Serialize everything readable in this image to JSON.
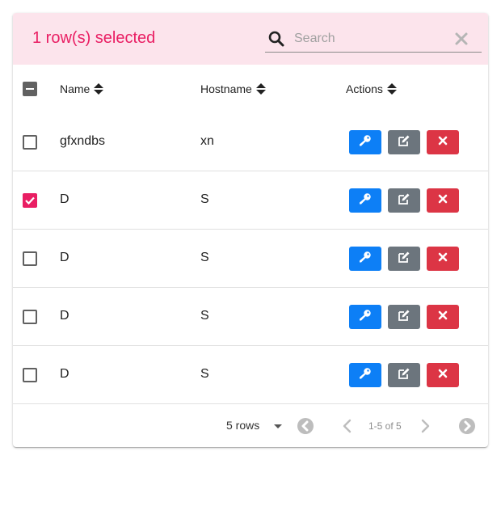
{
  "toolbar": {
    "selected_text": "1 row(s) selected",
    "search_placeholder": "Search",
    "search_value": ""
  },
  "columns": {
    "name": "Name",
    "hostname": "Hostname",
    "actions": "Actions"
  },
  "rows": [
    {
      "name": "gfxndbs",
      "hostname": "xn",
      "selected": false
    },
    {
      "name": "D",
      "hostname": "S",
      "selected": true
    },
    {
      "name": "D",
      "hostname": "S",
      "selected": false
    },
    {
      "name": "D",
      "hostname": "S",
      "selected": false
    },
    {
      "name": "D",
      "hostname": "S",
      "selected": false
    }
  ],
  "pagination": {
    "rows_per_page": "5 rows",
    "range": "1-5 of 5"
  },
  "colors": {
    "accent": "#e91e63",
    "toolbar_bg": "#fce4ec",
    "key_button": "#0d7ff6",
    "edit_button": "#6c757d",
    "delete_button": "#dc3545"
  },
  "icons": {
    "search": "search-icon",
    "clear": "close-icon",
    "sort": "sort-icon",
    "key": "key-icon",
    "edit": "edit-icon",
    "delete": "times-icon",
    "first_page": "first-page-icon",
    "previous_page": "chevron-left-icon",
    "next_page": "chevron-right-icon",
    "last_page": "last-page-icon",
    "dropdown": "caret-down-icon"
  }
}
